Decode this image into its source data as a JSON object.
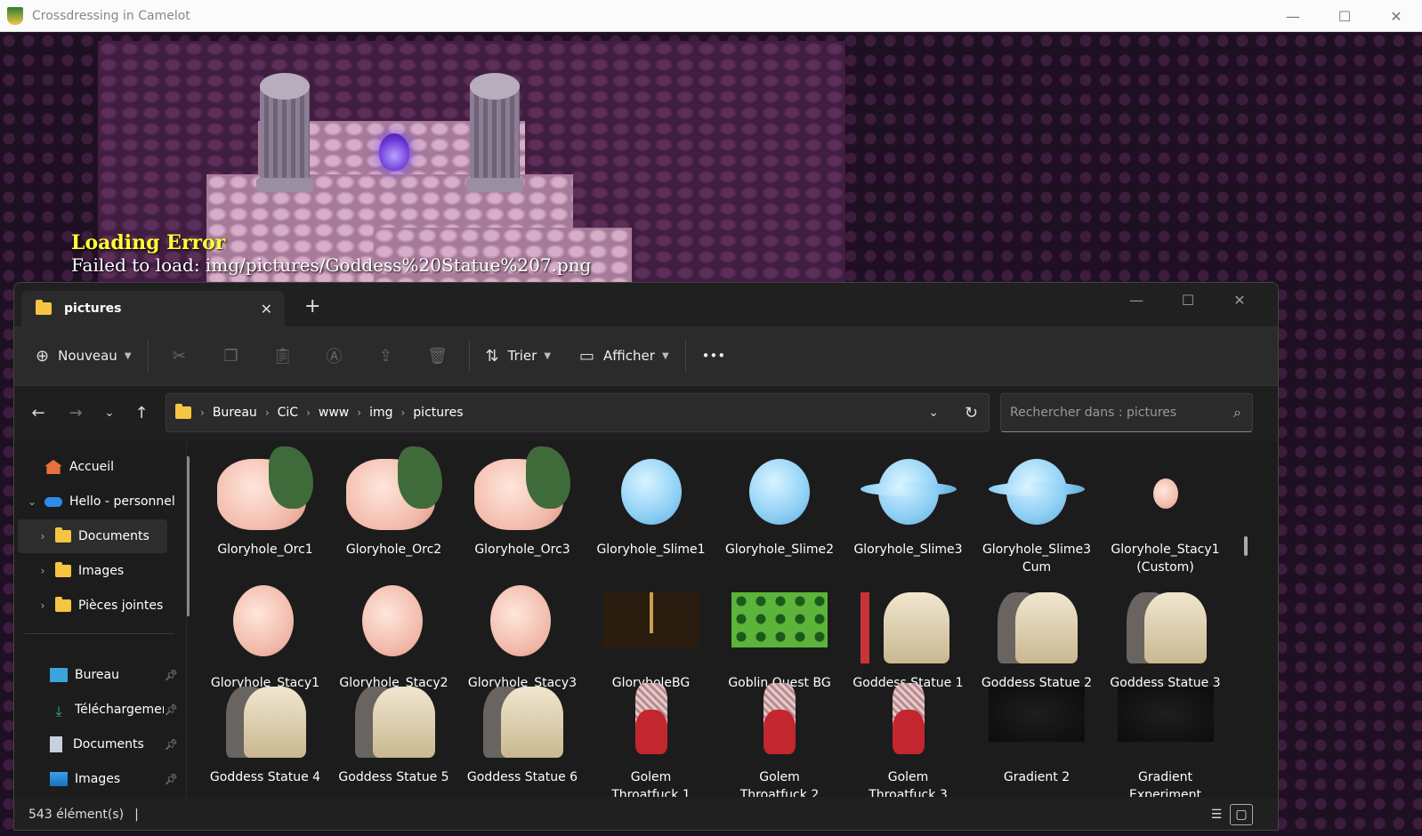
{
  "game_window": {
    "title": "Crossdressing in Camelot",
    "error_title": "Loading Error",
    "error_message": "Failed to load: img/pictures/Goddess%20Statue%207.png",
    "controls": {
      "minimize": "—",
      "maximize": "☐",
      "close": "✕"
    }
  },
  "explorer": {
    "tab": {
      "label": "pictures",
      "close": "✕",
      "new_tab": "+"
    },
    "window_controls": {
      "minimize": "—",
      "maximize": "☐",
      "close": "✕"
    },
    "toolbar": {
      "new_label": "Nouveau",
      "sort_label": "Trier",
      "view_label": "Afficher",
      "more_label": "•••"
    },
    "address": {
      "crumbs": [
        "Bureau",
        "CiC",
        "www",
        "img",
        "pictures"
      ]
    },
    "search": {
      "placeholder": "Rechercher dans : pictures"
    },
    "sidebar": {
      "items": [
        {
          "label": "Accueil",
          "icon": "home-icon"
        },
        {
          "label": "Hello - personnel",
          "icon": "cloud-icon"
        },
        {
          "label": "Documents",
          "icon": "folder-icon"
        },
        {
          "label": "Images",
          "icon": "folder-icon"
        },
        {
          "label": "Pièces jointes",
          "icon": "folder-icon"
        },
        {
          "label": "Bureau",
          "icon": "desktop-icon"
        },
        {
          "label": "Téléchargements",
          "icon": "download-icon"
        },
        {
          "label": "Documents",
          "icon": "document-icon"
        },
        {
          "label": "Images",
          "icon": "image-icon"
        }
      ]
    },
    "files": [
      {
        "line1": "Gloryhole_Orc1",
        "line2": ""
      },
      {
        "line1": "Gloryhole_Orc2",
        "line2": ""
      },
      {
        "line1": "Gloryhole_Orc3",
        "line2": ""
      },
      {
        "line1": "Gloryhole_Slime1",
        "line2": ""
      },
      {
        "line1": "Gloryhole_Slime2",
        "line2": ""
      },
      {
        "line1": "Gloryhole_Slime3",
        "line2": ""
      },
      {
        "line1": "Gloryhole_Slime3",
        "line2": "Cum"
      },
      {
        "line1": "Gloryhole_Stacy1",
        "line2": "(Custom)"
      },
      {
        "line1": "Gloryhole_Stacy1",
        "line2": ""
      },
      {
        "line1": "Gloryhole_Stacy2",
        "line2": ""
      },
      {
        "line1": "Gloryhole_Stacy3",
        "line2": ""
      },
      {
        "line1": "GloryholeBG",
        "line2": ""
      },
      {
        "line1": "Goblin Quest BG",
        "line2": ""
      },
      {
        "line1": "Goddess Statue 1",
        "line2": ""
      },
      {
        "line1": "Goddess Statue 2",
        "line2": ""
      },
      {
        "line1": "Goddess Statue 3",
        "line2": ""
      },
      {
        "line1": "Goddess Statue 4",
        "line2": ""
      },
      {
        "line1": "Goddess Statue 5",
        "line2": ""
      },
      {
        "line1": "Goddess Statue 6",
        "line2": ""
      },
      {
        "line1": "Golem",
        "line2": "Throatfuck 1"
      },
      {
        "line1": "Golem",
        "line2": "Throatfuck 2"
      },
      {
        "line1": "Golem",
        "line2": "Throatfuck 3"
      },
      {
        "line1": "Gradient 2",
        "line2": ""
      },
      {
        "line1": "Gradient",
        "line2": "Experiment"
      }
    ],
    "status": {
      "count": "543 élément(s)",
      "separator": "|"
    },
    "colors": {
      "accent": "#f5c542",
      "panel": "#1c1c1c",
      "toolbar": "#2b2b2b"
    }
  }
}
